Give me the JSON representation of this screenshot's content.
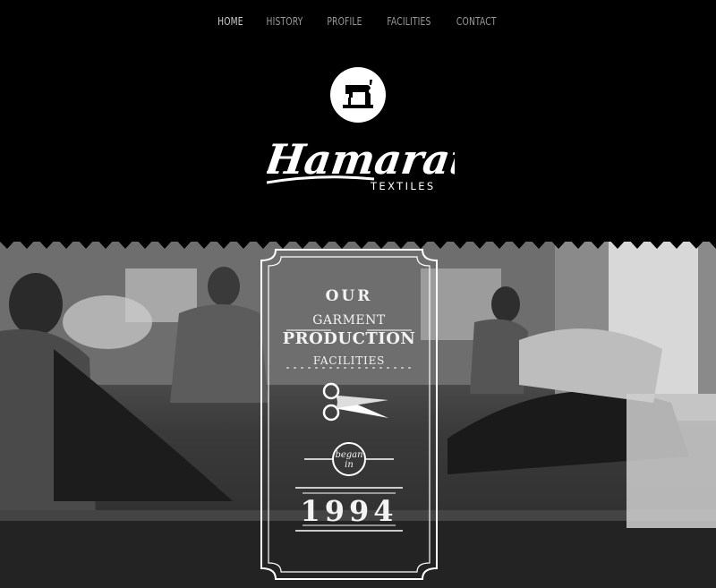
{
  "nav": {
    "items": [
      {
        "label": "HOME",
        "active": true
      },
      {
        "label": "HISTORY",
        "active": false
      },
      {
        "label": "PROFILE",
        "active": false
      },
      {
        "label": "FACILITIES",
        "active": false
      },
      {
        "label": "CONTACT",
        "active": false
      }
    ]
  },
  "brand": {
    "name": "Hamarath",
    "subtitle": "TEXTILES"
  },
  "hero": {
    "line1": "OUR",
    "line2": "GARMENT",
    "line3": "PRODUCTION",
    "line4": "FACILITIES",
    "began_1": "began",
    "began_2": "in",
    "year": "1994"
  },
  "colors": {
    "background": "#000000",
    "nav_text": "#9a9a9a",
    "nav_active": "#cfcfcf",
    "accent": "#ffffff"
  },
  "icons": {
    "logo": "sewing-machine-icon",
    "hero": "scissors-icon"
  }
}
